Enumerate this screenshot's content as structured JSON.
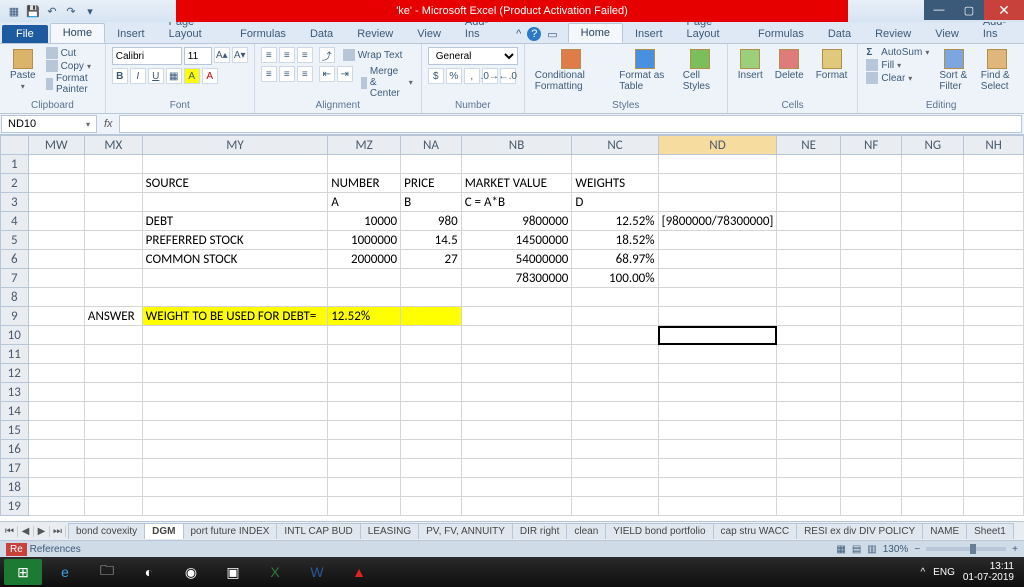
{
  "titlebar": {
    "center": "'ke' - Microsoft Excel (Product Activation Failed)"
  },
  "ribbonTabs": {
    "file": "File",
    "tabs": [
      "Home",
      "Insert",
      "Page Layout",
      "Formulas",
      "Data",
      "Review",
      "View",
      "Add-Ins"
    ],
    "active": 0
  },
  "ribbon": {
    "clipboard": {
      "label": "Clipboard",
      "paste": "Paste",
      "cut": "Cut",
      "copy": "Copy",
      "fp": "Format Painter"
    },
    "font": {
      "label": "Font",
      "name": "Calibri",
      "size": "11"
    },
    "alignment": {
      "label": "Alignment",
      "wrap": "Wrap Text",
      "merge": "Merge & Center"
    },
    "number": {
      "label": "Number",
      "format": "General"
    },
    "styles": {
      "label": "Styles",
      "cond": "Conditional Formatting",
      "tbl": "Format as Table",
      "cell": "Cell Styles"
    },
    "cells": {
      "label": "Cells",
      "insert": "Insert",
      "delete": "Delete",
      "format": "Format"
    },
    "editing": {
      "label": "Editing",
      "autosum": "AutoSum",
      "fill": "Fill",
      "clear": "Clear",
      "sort": "Sort & Filter",
      "find": "Find & Select"
    }
  },
  "namebox": "ND10",
  "formula": "",
  "columns": [
    "MW",
    "MX",
    "MY",
    "MZ",
    "NA",
    "NB",
    "NC",
    "ND",
    "NE",
    "NF",
    "NG",
    "NH"
  ],
  "selectedCol": "ND",
  "rows": 19,
  "activeCell": {
    "r": 10,
    "c": "ND"
  },
  "cells": {
    "2": {
      "MY": "SOURCE",
      "MZ": "NUMBER",
      "NA": "PRICE",
      "NB": "MARKET VALUE",
      "NC": "WEIGHTS"
    },
    "3": {
      "MZ": "A",
      "NA": "B",
      "NB": "C = A*B",
      "NC": "D"
    },
    "4": {
      "MY": "DEBT",
      "MZ": "10000",
      "NA": "980",
      "NB": "9800000",
      "NC": "12.52%",
      "ND": "[9800000/78300000]"
    },
    "5": {
      "MY": "PREFERRED STOCK",
      "MZ": "1000000",
      "NA": "14.5",
      "NB": "14500000",
      "NC": "18.52%"
    },
    "6": {
      "MY": "COMMON STOCK",
      "MZ": "2000000",
      "NA": "27",
      "NB": "54000000",
      "NC": "68.97%"
    },
    "7": {
      "NB": "78300000",
      "NC": "100.00%"
    },
    "9": {
      "MX": "ANSWER",
      "MY": "WEIGHT TO BE USED FOR DEBT=",
      "MZ": "12.52%"
    }
  },
  "highlight": {
    "row": 9,
    "cols": [
      "MY",
      "MZ",
      "NA"
    ]
  },
  "numericCols": [
    "MZ",
    "NA",
    "NB",
    "NC"
  ],
  "sheets": {
    "list": [
      "bond covexity",
      "DGM",
      "port future INDEX",
      "INTL CAP BUD",
      "LEASING",
      "PV, FV, ANNUITY",
      "DIR right",
      "clean",
      "YIELD bond portfolio",
      "cap stru WACC",
      "RESI ex div DIV POLICY",
      "NAME",
      "Sheet1"
    ],
    "active": "DGM"
  },
  "status": {
    "left": "Ready",
    "refs": "References",
    "zoom": "130%",
    "lang": "ENG"
  },
  "taskbar": {
    "time": "13:11",
    "date": "01-07-2019"
  }
}
